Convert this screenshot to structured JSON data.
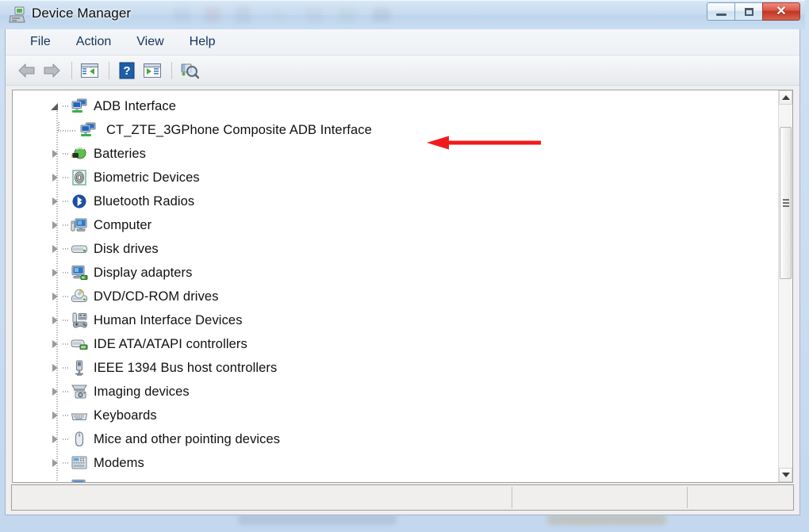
{
  "window": {
    "title": "Device Manager",
    "icon": "device-manager-icon",
    "controls": {
      "minimize": "—",
      "maximize": "□",
      "close": "✕"
    }
  },
  "menu": {
    "items": [
      {
        "label": "File"
      },
      {
        "label": "Action"
      },
      {
        "label": "View"
      },
      {
        "label": "Help"
      }
    ]
  },
  "toolbar": {
    "buttons": [
      {
        "name": "back-button",
        "icon": "arrow-left-icon",
        "tooltip": "Back"
      },
      {
        "name": "forward-button",
        "icon": "arrow-right-icon",
        "tooltip": "Forward"
      },
      {
        "name": "show-hide-console-tree-button",
        "icon": "console-tree-icon",
        "tooltip": "Show/Hide Console Tree"
      },
      {
        "name": "help-button",
        "icon": "question-mark-icon",
        "tooltip": "Help"
      },
      {
        "name": "properties-button",
        "icon": "properties-icon",
        "tooltip": "Properties"
      },
      {
        "name": "scan-hardware-changes-button",
        "icon": "scan-hardware-icon",
        "tooltip": "Scan for hardware changes"
      }
    ]
  },
  "tree": {
    "rows": [
      {
        "label": "ADB Interface",
        "level": 1,
        "state": "expanded",
        "icon": "adb-network-device-icon"
      },
      {
        "label": "CT_ZTE_3GPhone Composite ADB Interface",
        "level": 2,
        "state": "leaf",
        "icon": "adb-network-device-icon"
      },
      {
        "label": "Batteries",
        "level": 1,
        "state": "collapsed",
        "icon": "battery-icon"
      },
      {
        "label": "Biometric Devices",
        "level": 1,
        "state": "collapsed",
        "icon": "fingerprint-icon"
      },
      {
        "label": "Bluetooth Radios",
        "level": 1,
        "state": "collapsed",
        "icon": "bluetooth-icon"
      },
      {
        "label": "Computer",
        "level": 1,
        "state": "collapsed",
        "icon": "computer-icon"
      },
      {
        "label": "Disk drives",
        "level": 1,
        "state": "collapsed",
        "icon": "disk-drive-icon"
      },
      {
        "label": "Display adapters",
        "level": 1,
        "state": "collapsed",
        "icon": "display-adapter-icon"
      },
      {
        "label": "DVD/CD-ROM drives",
        "level": 1,
        "state": "collapsed",
        "icon": "optical-drive-icon"
      },
      {
        "label": "Human Interface Devices",
        "level": 1,
        "state": "collapsed",
        "icon": "gamepad-icon"
      },
      {
        "label": "IDE ATA/ATAPI controllers",
        "level": 1,
        "state": "collapsed",
        "icon": "ide-controller-icon"
      },
      {
        "label": "IEEE 1394 Bus host controllers",
        "level": 1,
        "state": "collapsed",
        "icon": "firewire-icon"
      },
      {
        "label": "Imaging devices",
        "level": 1,
        "state": "collapsed",
        "icon": "camera-scanner-icon"
      },
      {
        "label": "Keyboards",
        "level": 1,
        "state": "collapsed",
        "icon": "keyboard-icon"
      },
      {
        "label": "Mice and other pointing devices",
        "level": 1,
        "state": "collapsed",
        "icon": "mouse-icon"
      },
      {
        "label": "Modems",
        "level": 1,
        "state": "collapsed",
        "icon": "modem-icon"
      },
      {
        "label": "",
        "level": 1,
        "state": "collapsed",
        "icon": "monitor-icon"
      }
    ]
  },
  "scrollbar": {
    "up_arrow": "scroll-up-arrow-icon",
    "down_arrow": "scroll-down-arrow-icon",
    "thumb": "scroll-thumb"
  },
  "statusbar": {
    "cells": [
      "",
      "",
      ""
    ]
  },
  "annotation": {
    "arrow": "red-left-arrow",
    "color": "#f21b1b",
    "points_to": "CT_ZTE_3GPhone Composite ADB Interface"
  },
  "colors": {
    "titlebar": "#c5d9ee",
    "accent": "#14335e",
    "annotation_red": "#f21b1b",
    "close_button": "#c13423"
  }
}
